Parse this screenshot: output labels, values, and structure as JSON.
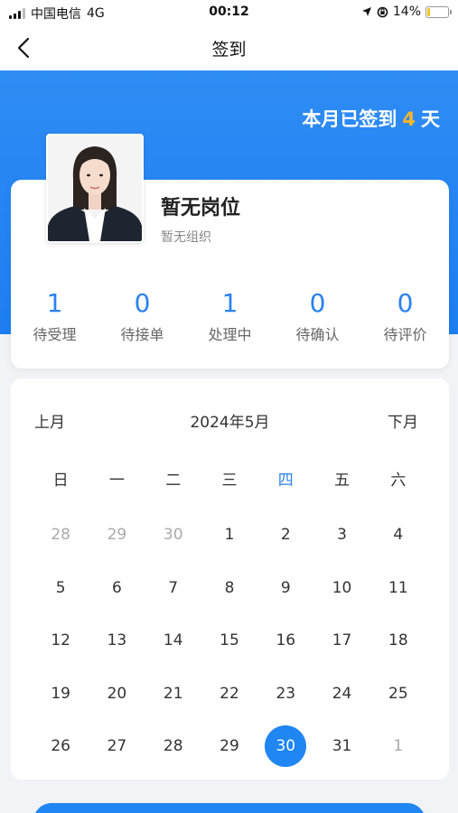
{
  "status_bar": {
    "carrier": "中国电信",
    "network": "4G",
    "time": "00:12",
    "battery": "14%",
    "battery_level": 0.14
  },
  "nav": {
    "title": "签到"
  },
  "hero": {
    "stats_prefix": "本月已签到",
    "stats_count": "4",
    "stats_suffix": "天"
  },
  "profile": {
    "name": "暂无岗位",
    "org": "暂无组织"
  },
  "counters": [
    {
      "value": "1",
      "label": "待受理"
    },
    {
      "value": "0",
      "label": "待接单"
    },
    {
      "value": "1",
      "label": "处理中"
    },
    {
      "value": "0",
      "label": "待确认"
    },
    {
      "value": "0",
      "label": "待评价"
    }
  ],
  "calendar": {
    "prev_label": "上月",
    "title": "2024年5月",
    "next_label": "下月",
    "weekdays": [
      "日",
      "一",
      "二",
      "三",
      "四",
      "五",
      "六"
    ],
    "today_weekday_index": 4,
    "days": [
      {
        "label": "28",
        "muted": true
      },
      {
        "label": "29",
        "muted": true
      },
      {
        "label": "30",
        "muted": true
      },
      {
        "label": "1"
      },
      {
        "label": "2"
      },
      {
        "label": "3"
      },
      {
        "label": "4"
      },
      {
        "label": "5"
      },
      {
        "label": "6"
      },
      {
        "label": "7"
      },
      {
        "label": "8"
      },
      {
        "label": "9"
      },
      {
        "label": "10"
      },
      {
        "label": "11"
      },
      {
        "label": "12"
      },
      {
        "label": "13"
      },
      {
        "label": "14"
      },
      {
        "label": "15"
      },
      {
        "label": "16"
      },
      {
        "label": "17"
      },
      {
        "label": "18"
      },
      {
        "label": "19"
      },
      {
        "label": "20"
      },
      {
        "label": "21"
      },
      {
        "label": "22"
      },
      {
        "label": "23"
      },
      {
        "label": "24"
      },
      {
        "label": "25"
      },
      {
        "label": "26"
      },
      {
        "label": "27"
      },
      {
        "label": "28"
      },
      {
        "label": "29"
      },
      {
        "label": "30",
        "selected": true
      },
      {
        "label": "31"
      },
      {
        "label": "1",
        "muted": true
      }
    ]
  },
  "colors": {
    "primary": "#1f86f2",
    "accent": "#f7b52c"
  }
}
